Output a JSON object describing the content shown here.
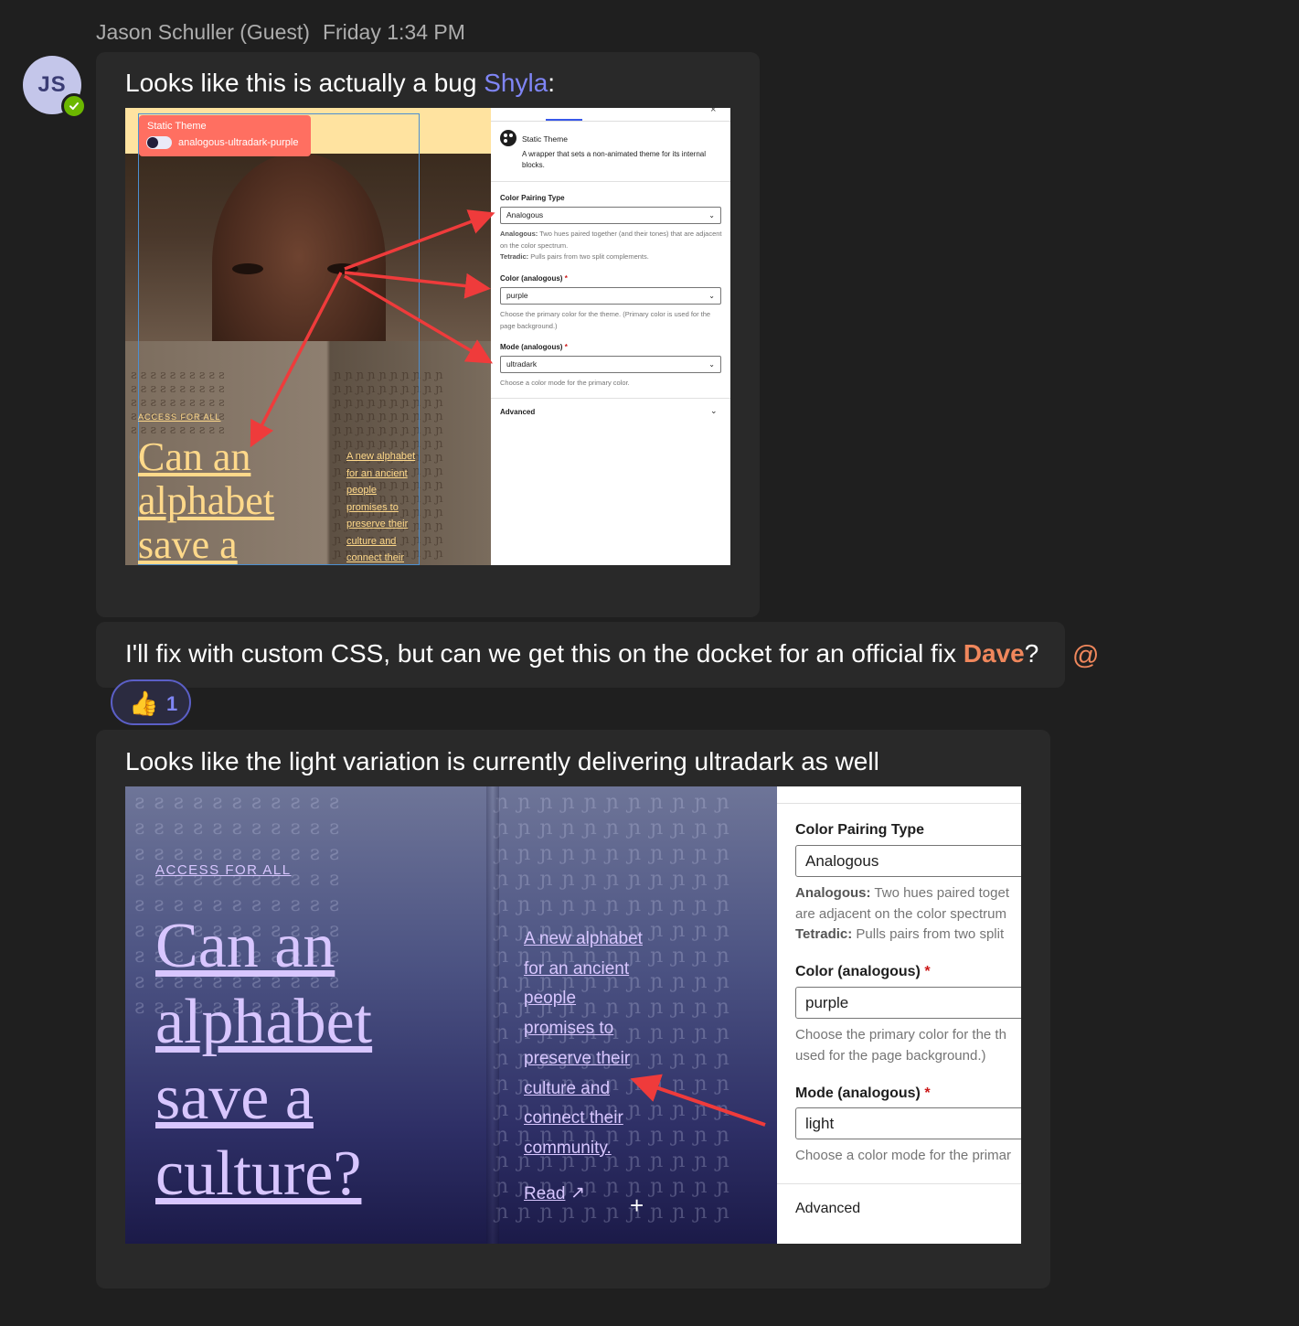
{
  "header": {
    "sender": "Jason Schuller (Guest)",
    "timestamp": "Friday 1:34 PM"
  },
  "avatar": {
    "initials": "JS",
    "status": "available"
  },
  "messages": [
    {
      "text_before": "Looks like this is actually a bug ",
      "mention": "Shyla",
      "text_after": ":"
    },
    {
      "text_before": "I'll fix with custom CSS, but can we get this on the docket for an official fix ",
      "mention": "Dave",
      "text_after": "?"
    },
    {
      "text": "Looks like the light variation is currently delivering ultradark as well"
    }
  ],
  "reaction": {
    "emoji": "👍",
    "count": "1"
  },
  "mention_icon": "@",
  "screenshot1": {
    "badge_title": "Static Theme",
    "badge_value": "analogous-ultradark-purple",
    "kicker": "ACCESS FOR ALL",
    "headline": [
      "Can an",
      "alphabet",
      "save a"
    ],
    "subhead": "A new alphabet\nfor an ancient\npeople\npromises to\npreserve their\nculture and\nconnect their",
    "panel": {
      "block_title": "Static Theme",
      "block_desc": "A wrapper that sets a non-animated theme for its internal blocks.",
      "pairing_label": "Color Pairing Type",
      "pairing_value": "Analogous",
      "pairing_help_analogous_label": "Analogous:",
      "pairing_help_analogous": " Two hues paired together (and their tones) that are adjacent on the color spectrum.",
      "pairing_help_tetradic_label": "Tetradic:",
      "pairing_help_tetradic": " Pulls pairs from two split complements.",
      "color_label": "Color (analogous)",
      "color_value": "purple",
      "color_help": "Choose the primary color for the theme. (Primary color is used for the page background.)",
      "mode_label": "Mode (analogous)",
      "mode_value": "ultradark",
      "mode_help": "Choose a color mode for the primary color.",
      "advanced": "Advanced"
    }
  },
  "screenshot2": {
    "kicker": "ACCESS FOR ALL",
    "headline": [
      "Can an",
      "alphabet",
      "save a",
      "culture?"
    ],
    "subhead": "A new alphabet\nfor an ancient\npeople\npromises to\npreserve their\nculture and\nconnect their\ncommunity.",
    "read": "Read",
    "panel": {
      "pairing_label": "Color Pairing Type",
      "pairing_value": "Analogous",
      "help_line1_label": "Analogous:",
      "help_line1": " Two hues paired toget",
      "help_line2": "are adjacent on the color spectrum",
      "help_line3_label": "Tetradic:",
      "help_line3": " Pulls pairs from two split",
      "color_label": "Color (analogous)",
      "color_value": "purple",
      "color_help1": "Choose the primary color for the th",
      "color_help2": "used for the page background.)",
      "mode_label": "Mode (analogous)",
      "mode_value": "light",
      "mode_help": "Choose a color mode for the primar",
      "advanced": "Advanced"
    }
  },
  "colors": {
    "background": "#1f1f1f",
    "bubble": "#292929",
    "mention_blue": "#7f85f5",
    "mention_orange": "#f0875c",
    "annotation_arrow": "#ef3b3b"
  }
}
